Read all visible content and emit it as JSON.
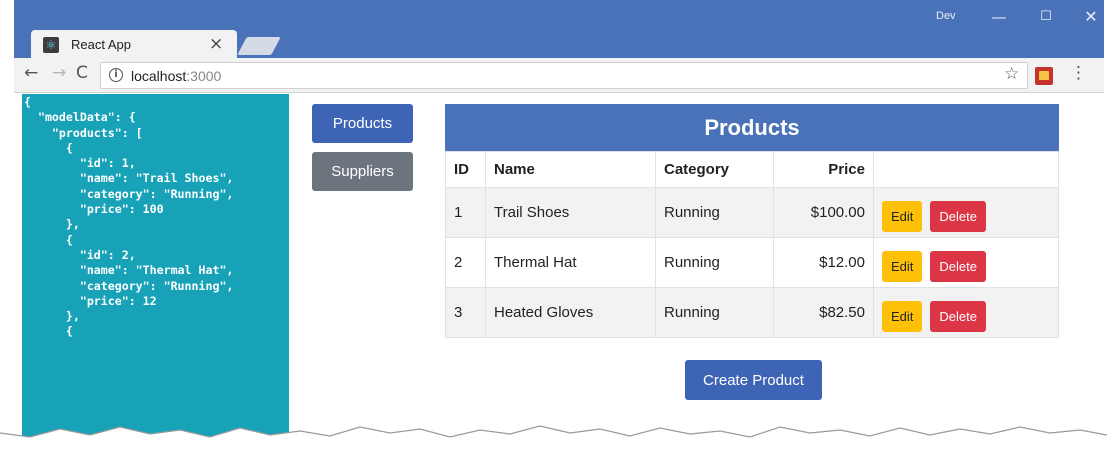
{
  "browser": {
    "tab_title": "React App",
    "tab_close": "×",
    "profile": "Dev",
    "window_controls": {
      "minimize": "—",
      "maximize": "☐",
      "close": "✕"
    },
    "nav": {
      "back": "←",
      "forward": "→",
      "reload": "C"
    },
    "address": {
      "host": "localhost",
      "port": ":3000"
    },
    "icons": {
      "info": "i",
      "star": "☆",
      "menu": "⋮"
    }
  },
  "json_panel": {
    "text": "{\n  \"modelData\": {\n    \"products\": [\n      {\n        \"id\": 1,\n        \"name\": \"Trail Shoes\",\n        \"category\": \"Running\",\n        \"price\": 100\n      },\n      {\n        \"id\": 2,\n        \"name\": \"Thermal Hat\",\n        \"category\": \"Running\",\n        \"price\": 12\n      },\n      {"
  },
  "nav_buttons": {
    "products": "Products",
    "suppliers": "Suppliers"
  },
  "table": {
    "title": "Products",
    "columns": {
      "id": "ID",
      "name": "Name",
      "category": "Category",
      "price": "Price"
    },
    "rows": [
      {
        "id": "1",
        "name": "Trail Shoes",
        "category": "Running",
        "price": "$100.00"
      },
      {
        "id": "2",
        "name": "Thermal Hat",
        "category": "Running",
        "price": "$12.00"
      },
      {
        "id": "3",
        "name": "Heated Gloves",
        "category": "Running",
        "price": "$82.50"
      }
    ],
    "edit_label": "Edit",
    "delete_label": "Delete"
  },
  "create_button": "Create Product",
  "colors": {
    "primary": "#3d64b5",
    "secondary": "#6c757d",
    "info": "#17a2b8",
    "warning": "#ffc107",
    "danger": "#dc3545"
  }
}
